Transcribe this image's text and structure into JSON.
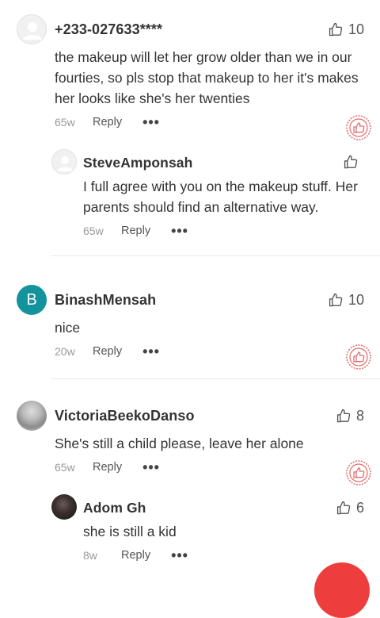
{
  "comments": [
    {
      "user": "+233-027633****",
      "likes": "10",
      "text": "the makeup will let her grow older than we in our fourties, so pls stop that makeup  to her it's makes her looks like she's her twenties",
      "time": "65w",
      "reply_label": "Reply",
      "more": "•••"
    },
    {
      "user": "SteveAmponsah",
      "likes": "",
      "text": "I full agree with you on the makeup stuff. Her parents should find an alternative way.",
      "time": "65w",
      "reply_label": "Reply",
      "more": "•••"
    },
    {
      "user": "BinashMensah",
      "avatar_letter": "B",
      "likes": "10",
      "text": "nice",
      "time": "20w",
      "reply_label": "Reply",
      "more": "•••"
    },
    {
      "user": "VictoriaBeekoDanso",
      "likes": "8",
      "text": "She's still a child please, leave her alone",
      "time": "65w",
      "reply_label": "Reply",
      "more": "•••"
    },
    {
      "user": "Adom Gh",
      "likes": "6",
      "text": "she is still a kid",
      "time": "8w",
      "reply_label": "Reply",
      "more": "•••"
    }
  ],
  "colors": {
    "accent_red": "#ee3d3d",
    "stamp_red": "#e36a6a",
    "teal_avatar": "#13939c"
  },
  "icons": {
    "like": "thumbs-up-icon",
    "stamp": "liked-stamp-icon",
    "more": "more-dots-icon",
    "fab": "compose-fab"
  }
}
